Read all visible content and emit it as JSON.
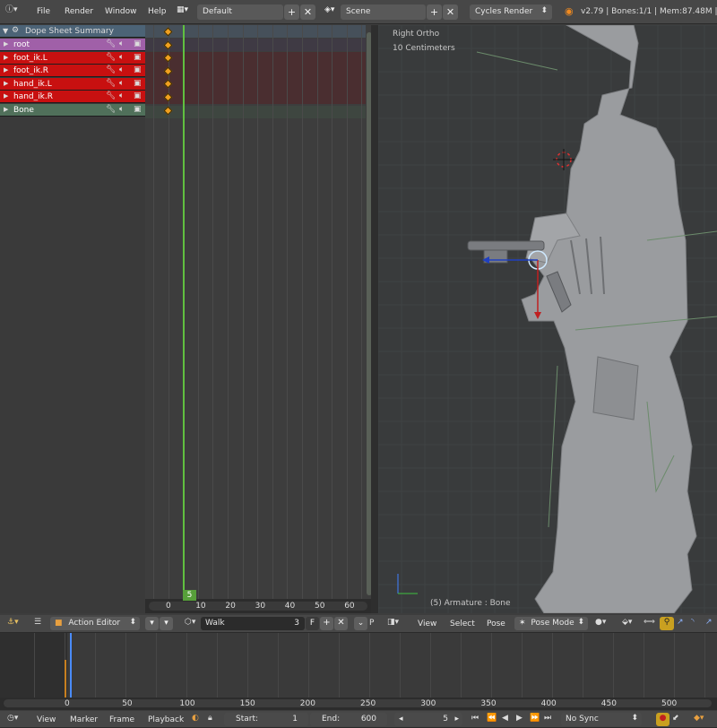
{
  "top_bar": {
    "menus": [
      "File",
      "Render",
      "Window",
      "Help"
    ],
    "layout": "Default",
    "scene": "Scene",
    "engine": "Cycles Render",
    "stats": "v2.79 | Bones:1/1 | Mem:87.48M | A"
  },
  "dopesheet": {
    "summary": "Dope Sheet Summary",
    "channels": [
      {
        "name": "root",
        "color": "#a060a8"
      },
      {
        "name": "foot_ik.L",
        "color": "#c81010"
      },
      {
        "name": "foot_ik.R",
        "color": "#c81010"
      },
      {
        "name": "hand_ik.L",
        "color": "#c81010"
      },
      {
        "name": "hand_ik.R",
        "color": "#c81010"
      },
      {
        "name": "Bone",
        "color": "#50705a"
      }
    ],
    "ruler": [
      "0",
      "10",
      "20",
      "30",
      "40",
      "50",
      "60"
    ],
    "current_frame": "5"
  },
  "viewport": {
    "view_name": "Right Ortho",
    "scale": "10 Centimeters",
    "object_info": "(5) Armature : Bone",
    "menus": [
      "View",
      "Select",
      "Pose"
    ],
    "mode": "Pose Mode"
  },
  "action_header": {
    "editor": "Action Editor",
    "action": "Walk",
    "users": "3",
    "fake_user": "F",
    "truncated": "P"
  },
  "timeline": {
    "ruler": [
      "0",
      "50",
      "100",
      "150",
      "200",
      "250",
      "300",
      "350",
      "400",
      "450",
      "500"
    ],
    "menus": [
      "View",
      "Marker",
      "Frame",
      "Playback"
    ],
    "start_label": "Start:",
    "start": "1",
    "end_label": "End:",
    "end": "600",
    "current": "5",
    "sync": "No Sync"
  }
}
